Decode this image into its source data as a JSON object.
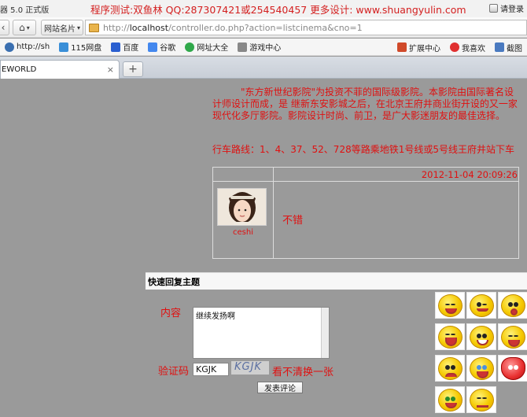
{
  "titlebar": {
    "app_title": "器 5.0 正式版",
    "promo": "程序测试:双鱼林 QQ:287307421或254540457 更多设计: www.shuangyulin.com",
    "login": "请登录"
  },
  "navbar": {
    "sites_label": "网站名片",
    "url_prefix": "http://",
    "url_host": "localhost",
    "url_path": "/controller.do.php?action=listcinema&cno=1"
  },
  "favorites": {
    "left": [
      {
        "label": "http://sh",
        "icon_color": "#3a6fb0"
      },
      {
        "label": "115网盘",
        "icon_color": "#3a8fd8"
      },
      {
        "label": "百度",
        "icon_color": "#2a5fd0"
      },
      {
        "label": "谷歌",
        "icon_color": "#4488ee"
      },
      {
        "label": "网址大全",
        "icon_color": "#2fa84a"
      },
      {
        "label": "游戏中心",
        "icon_color": "#888888"
      }
    ],
    "right": [
      {
        "label": "扩展中心",
        "icon_color": "#d04a2a"
      },
      {
        "label": "我喜欢",
        "icon_color": "#e03030"
      },
      {
        "label": "截图",
        "icon_color": "#4a7ac0"
      }
    ]
  },
  "tab": {
    "title": "EWORLD",
    "close": "×",
    "new_tab": "+"
  },
  "cinema": {
    "intro": "\"东方新世纪影院\"为投资不菲的国际级影院。本影院由国际著名设计师设计而成，是 继新东安影城之后，在北京王府井商业街开设的又一家现代化多厅影院。影院设计时尚、前卫，是广大影迷朋友的最佳选择。",
    "route": "行车路线：1、4、37、52、728等路乘地铁1号线或5号线王府井站下车"
  },
  "post": {
    "date": "2012-11-04 20:09:26",
    "username": "ceshi",
    "text": "不错"
  },
  "reply": {
    "header": "快速回复主题",
    "content_label": "内容",
    "content_value": "继续发扬啊",
    "captcha_label": "验证码",
    "captcha_value": "KGJK",
    "captcha_image_text": "KGJK",
    "refresh_label": "看不清换一张",
    "submit_label": "发表评论"
  },
  "emojis": [
    "laugh-emoji-icon",
    "wink-emoji-icon",
    "surprised-emoji-icon",
    "shout-emoji-icon",
    "grin-emoji-icon",
    "cry-emoji-icon",
    "angry-emoji-icon",
    "sob-emoji-icon",
    "heart-emoji-icon",
    "money-eyes-emoji-icon",
    "annoyed-emoji-icon"
  ]
}
